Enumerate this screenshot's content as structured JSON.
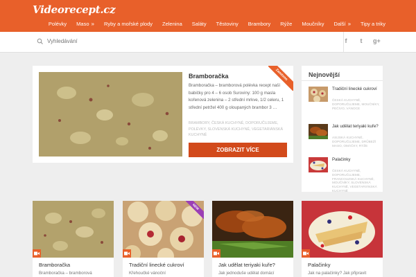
{
  "header": {
    "logo": "Videorecept.cz",
    "nav": [
      {
        "label": "Polévky",
        "chevron": false
      },
      {
        "label": "Maso",
        "chevron": true
      },
      {
        "label": "Ryby a mořské plody",
        "chevron": false
      },
      {
        "label": "Zelenina",
        "chevron": false
      },
      {
        "label": "Saláty",
        "chevron": false
      },
      {
        "label": "Těstoviny",
        "chevron": false
      },
      {
        "label": "Brambory",
        "chevron": false
      },
      {
        "label": "Rýže",
        "chevron": false
      },
      {
        "label": "Moučníky",
        "chevron": false
      },
      {
        "label": "Další",
        "chevron": true
      },
      {
        "label": "Tipy a triky",
        "chevron": false
      }
    ],
    "colors": {
      "brand": "#e8602a",
      "button": "#d24a1b",
      "new_badge": "#9b3fb5"
    }
  },
  "search": {
    "placeholder": "Vyhledávání",
    "icon": "search-icon",
    "social": [
      "f",
      "t",
      "g+"
    ]
  },
  "featured": {
    "title": "Bramboračka",
    "excerpt": "Bramboračka – bramborová polévka recept naší babičky pro 4 – 6 osob Suroviny: 100 g masla kořenová zelenina – 2 střední mrkve, 1/2 celeru, 1 střední petržel 400 g oloupaných brambor 3 …",
    "tags": "Brambory, Česká kuchyně, Doporučujeme, Polévky, Slovenská kuchyně, Vegetariánská kuchyně",
    "button": "ZOBRAZIT VÍCE",
    "corner_label": "Zamčeno"
  },
  "sidebar": {
    "title": "Nejnovější",
    "items": [
      {
        "title": "Tradiční linecké cukroví",
        "tags": "Česká kuchyně, Doporučujeme, Moučníky, Pečivo, Vánoce"
      },
      {
        "title": "Jak udělat teriyaki kuře?",
        "tags": "Asijská kuchyně, Doporučujeme, Drůbeží maso, Omáčky, Rýže"
      },
      {
        "title": "Palačinky",
        "tags": "Česká kuchyně, Doporučujeme, Francouzská kuchyně, Moučníky, Slovenská kuchyně, Vegetariánská kuchyně"
      }
    ]
  },
  "cards": [
    {
      "title": "Bramboračka",
      "excerpt": "Bramboračka – bramborová",
      "badge": ""
    },
    {
      "title": "Tradiční linecké cukroví",
      "excerpt": "Křehoučké vánoční",
      "badge": "NEW"
    },
    {
      "title": "Jak udělat teriyaki kuře?",
      "excerpt": "Jak jednoduše udělat domácí",
      "badge": ""
    },
    {
      "title": "Palačinky",
      "excerpt": "Jak na palačinky? Jak připravit",
      "badge": ""
    }
  ]
}
